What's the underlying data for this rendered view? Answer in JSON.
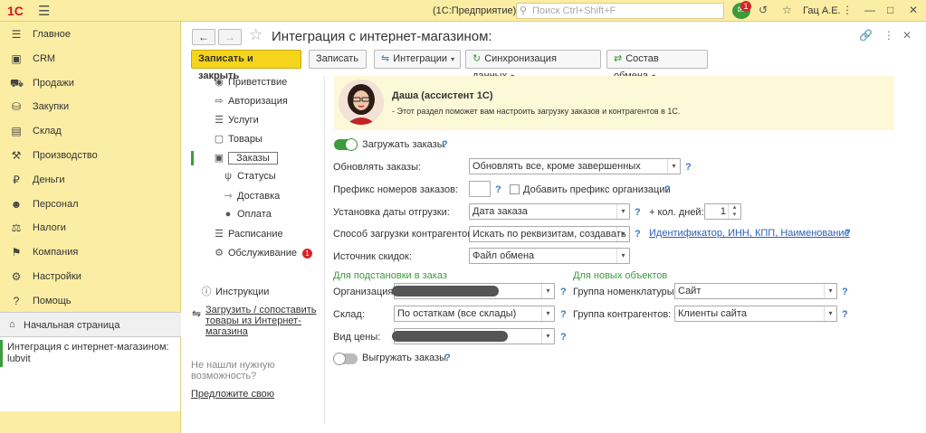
{
  "topbar": {
    "logo": "1С",
    "app_title": "(1С:Предприятие)",
    "search_placeholder": "Поиск Ctrl+Shift+F",
    "notifications_count": "1",
    "user": "Гац А.Е."
  },
  "sidebar": {
    "items": [
      {
        "label": "Главное",
        "icon": "menu-icon"
      },
      {
        "label": "CRM",
        "icon": "crm-icon"
      },
      {
        "label": "Продажи",
        "icon": "cart-icon"
      },
      {
        "label": "Закупки",
        "icon": "purchase-icon"
      },
      {
        "label": "Склад",
        "icon": "warehouse-icon"
      },
      {
        "label": "Производство",
        "icon": "factory-icon"
      },
      {
        "label": "Деньги",
        "icon": "ruble-icon"
      },
      {
        "label": "Персонал",
        "icon": "person-icon"
      },
      {
        "label": "Налоги",
        "icon": "taxes-icon"
      },
      {
        "label": "Компания",
        "icon": "company-icon"
      },
      {
        "label": "Настройки",
        "icon": "gear-icon"
      },
      {
        "label": "Помощь",
        "icon": "help-icon"
      }
    ],
    "home": "Начальная страница",
    "open_window": "Интеграция с интернет-магазином: lubvit"
  },
  "form": {
    "title": "Интеграция с интернет-магазином:",
    "toolbar": {
      "save_close": "Записать и закрыть",
      "save": "Записать",
      "integrations": "Интеграции",
      "sync": "Синхронизация данных",
      "exchange": "Состав обмена"
    },
    "nav": [
      {
        "label": "Приветствие"
      },
      {
        "label": "Авторизация"
      },
      {
        "label": "Услуги"
      },
      {
        "label": "Товары"
      },
      {
        "label": "Заказы"
      },
      {
        "label": "Статусы"
      },
      {
        "label": "Доставка"
      },
      {
        "label": "Оплата"
      },
      {
        "label": "Расписание"
      },
      {
        "label": "Обслуживание",
        "badge": "1"
      }
    ],
    "instructions": "Инструкции",
    "load_link": "Загрузить / сопоставить товары из Интернет-магазина",
    "not_found": "Не нашли нужную возможность?",
    "suggest": "Предложите свою",
    "assistant": {
      "name": "Даша (ассистент 1С)",
      "text": "- Этот раздел поможет вам настроить загрузку заказов и контрагентов в 1С."
    },
    "fields": {
      "load_orders": "Загружать заказы",
      "update_orders_label": "Обновлять заказы:",
      "update_orders_value": "Обновлять все, кроме завершенных",
      "prefix_label": "Префикс номеров заказов:",
      "prefix_value": "",
      "add_prefix": "Добавить префикс организации",
      "ship_date_label": "Установка даты отгрузки:",
      "ship_date_value": "Дата заказа",
      "days_label": "+ кол. дней:",
      "days_value": "1",
      "contractor_label": "Способ загрузки контрагентов:",
      "contractor_value": "Искать по реквизитам, создавать",
      "contractor_link": "Идентификатор, ИНН, КПП, Наименование",
      "discount_label": "Источник скидок:",
      "discount_value": "Файл обмена",
      "section_order": "Для подстановки в заказ",
      "section_new": "Для новых объектов",
      "org_label": "Организация:",
      "warehouse_label": "Склад:",
      "warehouse_value": "По остаткам (все склады)",
      "price_label": "Вид цены:",
      "nomen_group_label": "Группа номенклатуры:",
      "nomen_group_value": "Сайт",
      "contr_group_label": "Группа контрагентов:",
      "contr_group_value": "Клиенты сайта",
      "unload_orders": "Выгружать заказы",
      "help": "?"
    }
  }
}
